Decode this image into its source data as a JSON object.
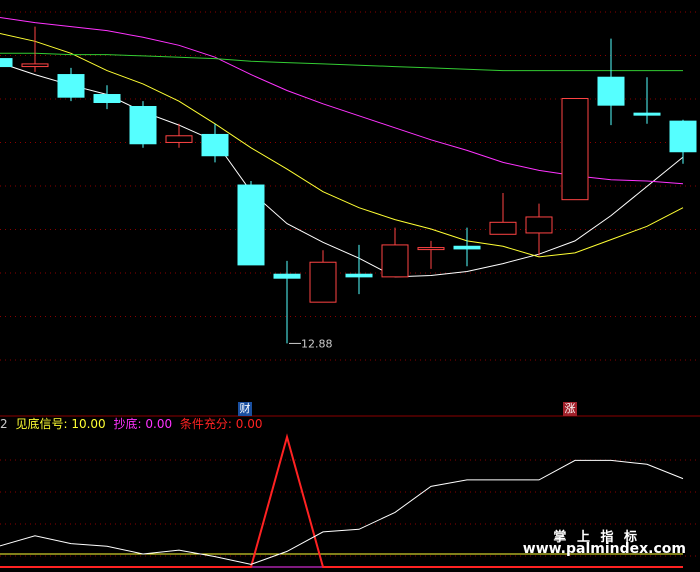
{
  "chart_data": [
    {
      "type": "candlestick",
      "ylim": [
        12.5,
        15.4
      ],
      "candles": [
        {
          "o": 15.02,
          "c": 14.96,
          "h": 15.12,
          "l": 14.94,
          "color": "cyan"
        },
        {
          "o": 14.96,
          "c": 14.98,
          "h": 15.26,
          "l": 14.92,
          "color": "red"
        },
        {
          "o": 14.9,
          "c": 14.73,
          "h": 14.95,
          "l": 14.7,
          "color": "cyan"
        },
        {
          "o": 14.75,
          "c": 14.69,
          "h": 14.82,
          "l": 14.64,
          "color": "cyan"
        },
        {
          "o": 14.66,
          "c": 14.38,
          "h": 14.7,
          "l": 14.35,
          "color": "cyan"
        },
        {
          "o": 14.39,
          "c": 14.44,
          "h": 14.53,
          "l": 14.35,
          "color": "red"
        },
        {
          "o": 14.45,
          "c": 14.29,
          "h": 14.53,
          "l": 14.24,
          "color": "cyan"
        },
        {
          "o": 14.07,
          "c": 13.47,
          "h": 14.1,
          "l": 13.47,
          "color": "cyan"
        },
        {
          "o": 13.4,
          "c": 13.37,
          "h": 13.5,
          "l": 12.88,
          "color": "cyan"
        },
        {
          "o": 13.19,
          "c": 13.49,
          "h": 13.58,
          "l": 13.19,
          "color": "red"
        },
        {
          "o": 13.4,
          "c": 13.38,
          "h": 13.62,
          "l": 13.25,
          "color": "cyan"
        },
        {
          "o": 13.38,
          "c": 13.62,
          "h": 13.75,
          "l": 13.38,
          "color": "red"
        },
        {
          "o": 13.59,
          "c": 13.6,
          "h": 13.65,
          "l": 13.44,
          "color": "red"
        },
        {
          "o": 13.61,
          "c": 13.59,
          "h": 13.75,
          "l": 13.46,
          "color": "cyan"
        },
        {
          "o": 13.7,
          "c": 13.79,
          "h": 14.01,
          "l": 13.7,
          "color": "red"
        },
        {
          "o": 13.71,
          "c": 13.83,
          "h": 13.93,
          "l": 13.54,
          "color": "red"
        },
        {
          "o": 13.96,
          "c": 14.72,
          "h": 14.72,
          "l": 13.96,
          "color": "red"
        },
        {
          "o": 14.88,
          "c": 14.67,
          "h": 15.17,
          "l": 14.52,
          "color": "cyan"
        },
        {
          "o": 14.61,
          "c": 14.6,
          "h": 14.88,
          "l": 14.53,
          "color": "cyan"
        },
        {
          "o": 14.55,
          "c": 14.32,
          "h": 14.56,
          "l": 14.23,
          "color": "cyan"
        }
      ],
      "series": [
        {
          "color": "#ffffff",
          "values": [
            14.99,
            14.9,
            14.82,
            14.75,
            14.62,
            14.52,
            14.4,
            14.02,
            13.78,
            13.64,
            13.52,
            13.38,
            13.39,
            13.42,
            13.48,
            13.55,
            13.65,
            13.84,
            14.06,
            14.28
          ]
        },
        {
          "color": "#ffff33",
          "values": [
            15.21,
            15.15,
            15.06,
            14.93,
            14.83,
            14.7,
            14.53,
            14.35,
            14.19,
            14.02,
            13.9,
            13.81,
            13.74,
            13.65,
            13.61,
            13.53,
            13.56,
            13.66,
            13.76,
            13.9
          ]
        },
        {
          "color": "#ff33ff",
          "values": [
            15.33,
            15.29,
            15.26,
            15.23,
            15.18,
            15.12,
            15.03,
            14.9,
            14.78,
            14.68,
            14.59,
            14.5,
            14.41,
            14.33,
            14.24,
            14.18,
            14.14,
            14.11,
            14.1,
            14.08
          ]
        },
        {
          "color": "#33cc33",
          "values": [
            15.06,
            15.06,
            15.05,
            15.05,
            15.04,
            15.03,
            15.02,
            15.0,
            14.99,
            14.98,
            14.97,
            14.96,
            14.95,
            14.94,
            14.93,
            14.93,
            14.93,
            14.93,
            14.93,
            14.93
          ]
        }
      ],
      "low_label": "12.88"
    },
    {
      "type": "line",
      "ylim": [
        0,
        100
      ],
      "series": [
        {
          "name": "见底信号",
          "color": "#ffff33",
          "values": [
            10,
            10,
            10,
            10,
            10,
            10,
            10,
            10,
            10,
            10,
            10,
            10,
            10,
            10,
            10,
            10,
            10,
            10,
            10,
            10
          ]
        },
        {
          "name": "抄底",
          "color": "#ff33ff",
          "values": [
            0,
            0,
            0,
            0,
            0,
            0,
            0,
            0,
            0,
            0,
            0,
            0,
            0,
            0,
            0,
            0,
            0,
            0,
            0,
            0
          ]
        },
        {
          "name": "条件充分",
          "color": "#ff2222",
          "values": [
            0,
            0,
            0,
            0,
            0,
            0,
            0,
            0,
            100,
            0,
            0,
            0,
            0,
            0,
            0,
            0,
            0,
            0,
            0,
            0
          ]
        },
        {
          "color": "#ffffff",
          "values": [
            16,
            24,
            18,
            16,
            10,
            13,
            8,
            2,
            12,
            27,
            29,
            42,
            62,
            67,
            67,
            67,
            82,
            82,
            79,
            68
          ]
        }
      ]
    }
  ],
  "legend": {
    "prefix": "2",
    "items": [
      {
        "label": "见底信号: 10.00",
        "color": "#ffff33"
      },
      {
        "label": "抄底: 0.00",
        "color": "#ff33ff"
      },
      {
        "label": "条件充分: 0.00",
        "color": "#ff2222"
      }
    ]
  },
  "badges": [
    {
      "text": "财",
      "bg": "#1a4fa0"
    },
    {
      "text": "涨",
      "bg": "#a0202a"
    }
  ],
  "watermark": {
    "cn": "掌 上 指 标",
    "url": "www.palmindex.com"
  },
  "colors": {
    "up": "#ff4444",
    "down": "#55ffff",
    "grid": "#8b0000",
    "separator": "#8b0000"
  }
}
